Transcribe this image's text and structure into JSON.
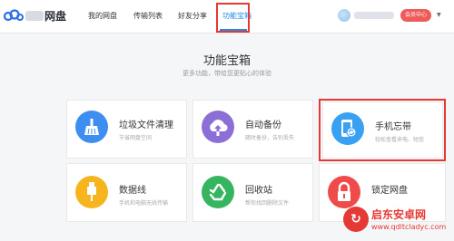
{
  "header": {
    "logo_text": "网盘",
    "nav": [
      {
        "label": "我的网盘"
      },
      {
        "label": "传输列表"
      },
      {
        "label": "好友分享"
      },
      {
        "label": "功能宝箱"
      }
    ],
    "active_index": 3,
    "vip_label": "会员中心"
  },
  "main": {
    "title": "功能宝箱",
    "subtitle": "更多功能，带给您更贴心的体验",
    "cards": [
      {
        "title": "垃圾文件清理",
        "desc": "节省网盘空间",
        "icon": "broom-icon",
        "color": "#3d8ef0"
      },
      {
        "title": "自动备份",
        "desc": "随时备份，告别丢失",
        "icon": "cloud-upload-icon",
        "color": "#8b6fd6"
      },
      {
        "title": "手机忘带",
        "desc": "轻松查看来电、短信",
        "icon": "phone-sync-icon",
        "color": "#3aa0f2"
      },
      {
        "title": "数据线",
        "desc": "手机和电脑无线传输",
        "icon": "usb-cable-icon",
        "color": "#f6b51e"
      },
      {
        "title": "回收站",
        "desc": "帮你找回删除文件",
        "icon": "recycle-icon",
        "color": "#35b560"
      },
      {
        "title": "锁定网盘",
        "desc": "",
        "icon": "lock-icon",
        "color": "#ef4b4b"
      }
    ]
  },
  "watermark": {
    "title": "启东安卓网",
    "url": "www.qdltcladyc.com"
  },
  "colors": {
    "accent": "#1f8ceb",
    "highlight": "#e53935"
  }
}
